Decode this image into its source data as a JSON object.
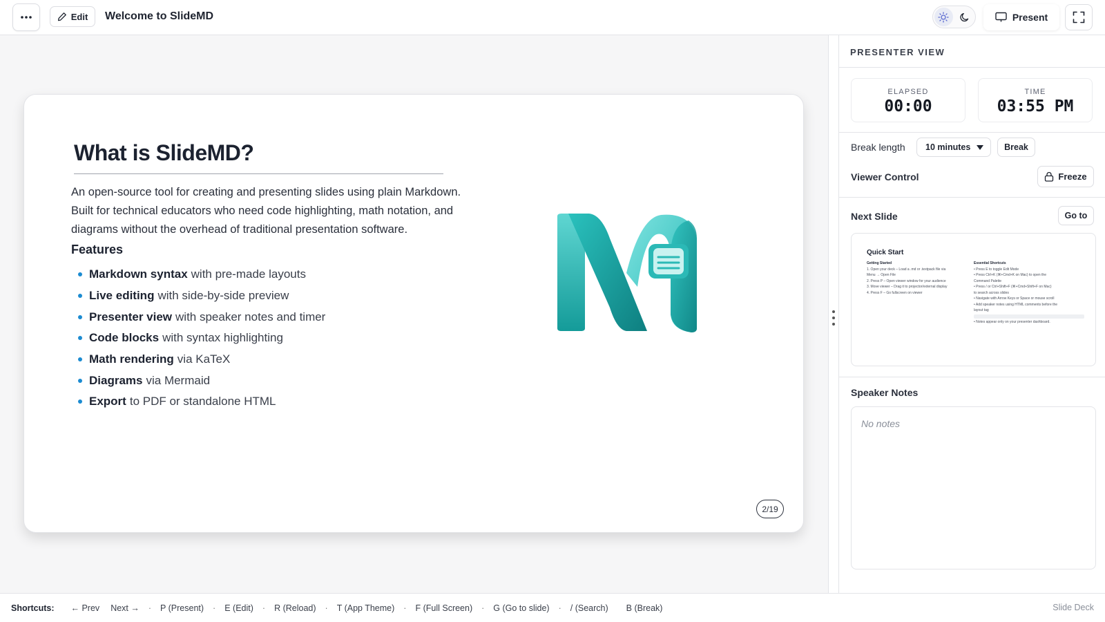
{
  "app": {
    "title": "Welcome to SlideMD",
    "edit_label": "Edit",
    "present_label": "Present"
  },
  "slide": {
    "title": "What is SlideMD?",
    "intro": "An open-source tool for creating and presenting slides using plain Markdown. Built for technical educators who need code highlighting, math notation, and diagrams without the overhead of traditional presentation software.",
    "features_heading": "Features",
    "features": [
      {
        "bold": "Markdown syntax",
        "rest": "with pre-made layouts"
      },
      {
        "bold": "Live editing",
        "rest": "with side-by-side preview"
      },
      {
        "bold": "Presenter view",
        "rest": "with speaker notes and timer"
      },
      {
        "bold": "Code blocks",
        "rest": "with syntax highlighting"
      },
      {
        "bold": "Math rendering",
        "rest": "via KaTeX"
      },
      {
        "bold": "Diagrams",
        "rest": "via Mermaid"
      },
      {
        "bold": "Export",
        "rest": "to PDF or standalone HTML"
      }
    ],
    "page_indicator": "2/19",
    "accent_color": "#1b8bd1",
    "logo_colors": [
      "#2cc4c4",
      "#1a9a9a"
    ]
  },
  "presenter": {
    "heading": "PRESENTER VIEW",
    "elapsed_label": "ELAPSED",
    "elapsed_value": "00:00",
    "time_label": "TIME",
    "time_value": "03:55 PM",
    "break_length_label": "Break length",
    "break_length_value": "10 minutes",
    "break_button": "Break",
    "viewer_control_label": "Viewer Control",
    "freeze_button": "Freeze",
    "next_slide_label": "Next Slide",
    "goto_button": "Go to",
    "next_slide_preview": {
      "title": "Quick Start",
      "left_heading": "Getting Started",
      "left_items": [
        "1. Open your deck – Load a .md or .textpack file via",
        "   Menu → Open File",
        "2. Press P – Open viewer window for your audience",
        "3. Move viewer – Drag it to projector/external display",
        "4. Press F – Go fullscreen on viewer"
      ],
      "right_heading": "Essential Shortcuts",
      "right_items": [
        "• Press E to toggle Edit Mode",
        "• Press Ctrl+K (⌘+Cmd+K on Mac) to open the",
        "  Command Palette",
        "• Press / or Ctrl+Shift+F (⌘+Cmd+Shift+F on Mac)",
        "  to search across slides",
        "• Navigate with Arrow Keys or Space or mouse scroll",
        "• Add speaker notes using HTML comments before the",
        "  layout tag",
        "",
        "• Notes appear only on your presenter dashboard."
      ]
    },
    "speaker_notes_label": "Speaker Notes",
    "speaker_notes_empty": "No notes"
  },
  "shortcuts": {
    "label": "Shortcuts:",
    "items": [
      "← Prev",
      "Next →",
      "P (Present)",
      "E (Edit)",
      "R (Reload)",
      "T (App Theme)",
      "F (Full Screen)",
      "G (Go to slide)",
      "/ (Search)",
      "B (Break)"
    ],
    "deck_name": "Slide Deck"
  },
  "icons": {
    "menu": "more-horizontal-icon",
    "edit": "pencil-icon",
    "light": "sun-icon",
    "dark": "moon-icon",
    "present": "monitor-icon",
    "fullscreen": "expand-icon",
    "freeze": "lock-icon"
  }
}
